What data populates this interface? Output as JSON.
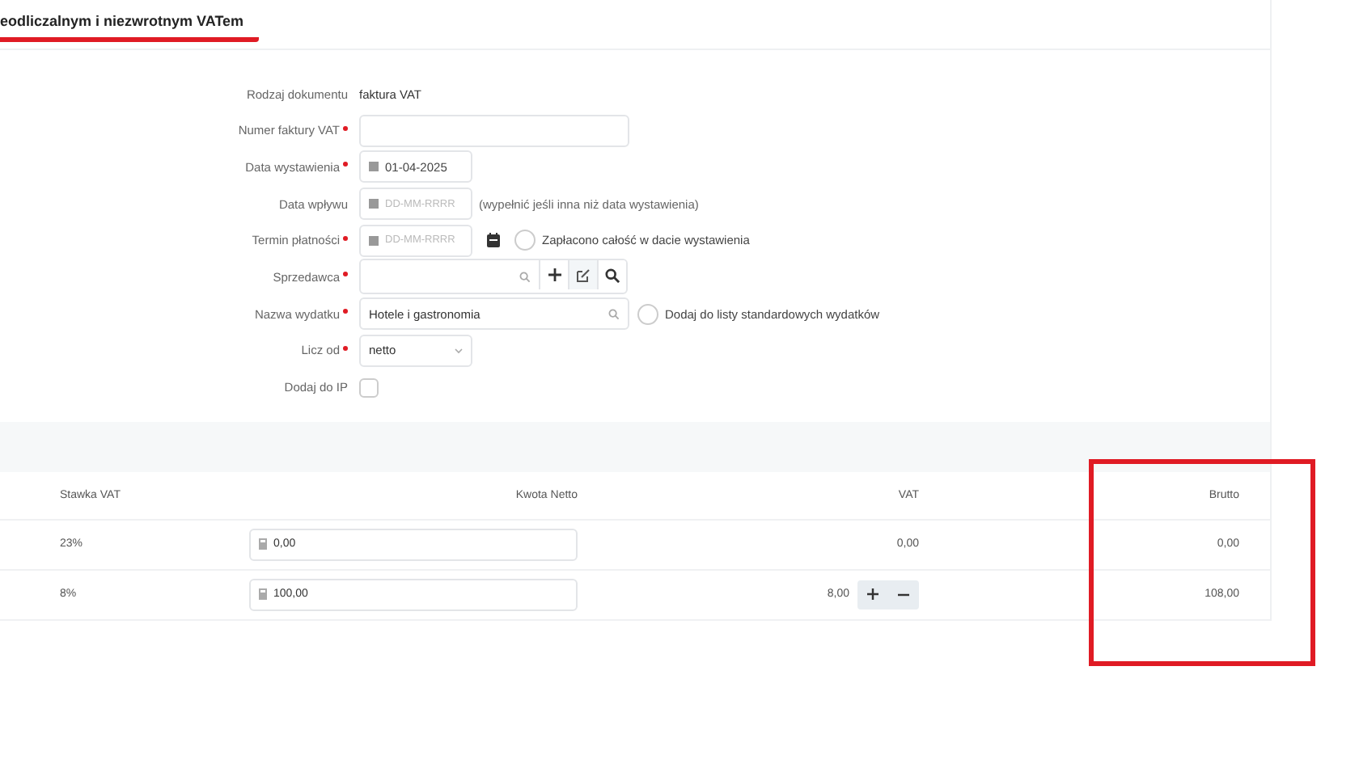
{
  "tab": {
    "title": "eodliczalnym i niezwrotnym VATem",
    "selected": true
  },
  "form": {
    "rows": [
      {
        "kind": "text",
        "label": "Rodzaj dokumentu",
        "required": false,
        "value": "faktura VAT"
      },
      {
        "kind": "input",
        "label": "Numer faktury VAT",
        "required": true
      },
      {
        "kind": "date",
        "label": "Data wystawienia",
        "required": true,
        "value": "01-04-2025"
      },
      {
        "kind": "date",
        "label": "Data wpływu",
        "required": false,
        "placeholder": "DD-MM-RRRR",
        "note": "(wypełnić jeśli inna niż data wystawienia)"
      },
      {
        "kind": "date",
        "label": "Termin płatności",
        "required": true,
        "placeholder": "DD-MM-RRRR",
        "calendar_button": true,
        "checkbox": {
          "label": "Zapłacono całość w dacie wystawienia",
          "checked": false
        }
      },
      {
        "kind": "lookup",
        "label": "Sprzedawca",
        "required": true
      },
      {
        "kind": "search",
        "label": "Nazwa wydatku",
        "required": true,
        "value": "Hotele i gastronomia",
        "checkbox": {
          "label": "Dodaj do listy standardowych wydatków",
          "checked": false
        }
      },
      {
        "kind": "select",
        "label": "Licz od",
        "required": true,
        "value": "netto"
      },
      {
        "kind": "checkbox",
        "label": "Dodaj do IP",
        "required": false,
        "checked": false
      }
    ]
  },
  "table": {
    "columns": [
      "Stawka VAT",
      "Kwota Netto",
      "VAT",
      "Brutto"
    ],
    "rows": [
      {
        "rate": "23%",
        "net": "0,00",
        "vat": "0,00",
        "gross": "0,00",
        "adjust_buttons": false
      },
      {
        "rate": "8%",
        "net": "100,00",
        "vat": "8,00",
        "gross": "108,00",
        "adjust_buttons": true
      }
    ]
  },
  "annotations": [
    {
      "kind": "rectangle"
    }
  ]
}
